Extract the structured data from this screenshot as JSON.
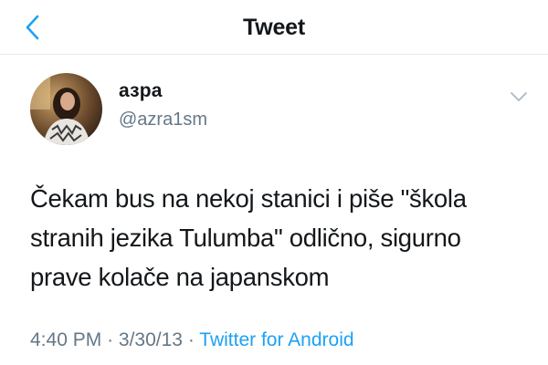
{
  "header": {
    "title": "Tweet",
    "back_icon": "chevron-left-icon",
    "accent_color": "#1da1f2"
  },
  "tweet": {
    "author": {
      "display_name": "азра",
      "handle": "@azra1sm"
    },
    "text_lines": [
      "Čekam bus na nekoj stanici i piše \"škola",
      "stranih jezika Tulumba\" odlično, sigurno",
      "prave kolače na japanskom"
    ],
    "time": "4:40 PM",
    "separator": "·",
    "date": "3/30/13",
    "source": "Twitter for Android",
    "menu_icon": "chevron-down-icon"
  }
}
